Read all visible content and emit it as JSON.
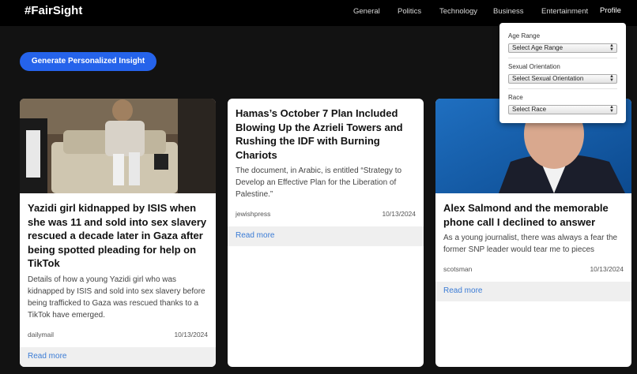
{
  "brand": "#FairSight",
  "nav": {
    "general": "General",
    "politics": "Politics",
    "technology": "Technology",
    "business": "Business",
    "entertainment": "Entertainment",
    "profile": "Profile"
  },
  "generate_button": "Generate Personalized Insight",
  "filters": {
    "age": {
      "label": "Age Range",
      "selected": "Select Age Range"
    },
    "orientation": {
      "label": "Sexual Orientation",
      "selected": "Select Sexual Orientation"
    },
    "race": {
      "label": "Race",
      "selected": "Select Race"
    }
  },
  "articles": [
    {
      "title": "Yazidi girl kidnapped by ISIS when she was 11 and sold into sex slavery rescued a decade later in Gaza after being spotted pleading for help on TikTok",
      "description": "Details of how a young Yazidi girl who was kidnapped by ISIS and sold into sex slavery before being trafficked to Gaza was rescued thanks to a TikTok have emerged.",
      "source": "dailymail",
      "date": "10/13/2024",
      "link": "Read more"
    },
    {
      "title": "Hamas’s October 7 Plan Included Blowing Up the Azrieli Towers and Rushing the IDF with Burning Chariots",
      "description": "The document, in Arabic, is entitled “Strategy to Develop an Effective Plan for the Liberation of Palestine.”",
      "source": "jewishpress",
      "date": "10/13/2024",
      "link": "Read more"
    },
    {
      "title": "Alex Salmond and the memorable phone call I declined to answer",
      "description": "As a young journalist, there was always a fear the former SNP leader would tear me to pieces",
      "source": "scotsman",
      "date": "10/13/2024",
      "link": "Read more"
    }
  ],
  "colors": {
    "accent": "#2563eb",
    "link": "#3a7bd5",
    "background": "#121212",
    "topbar": "#000000"
  }
}
